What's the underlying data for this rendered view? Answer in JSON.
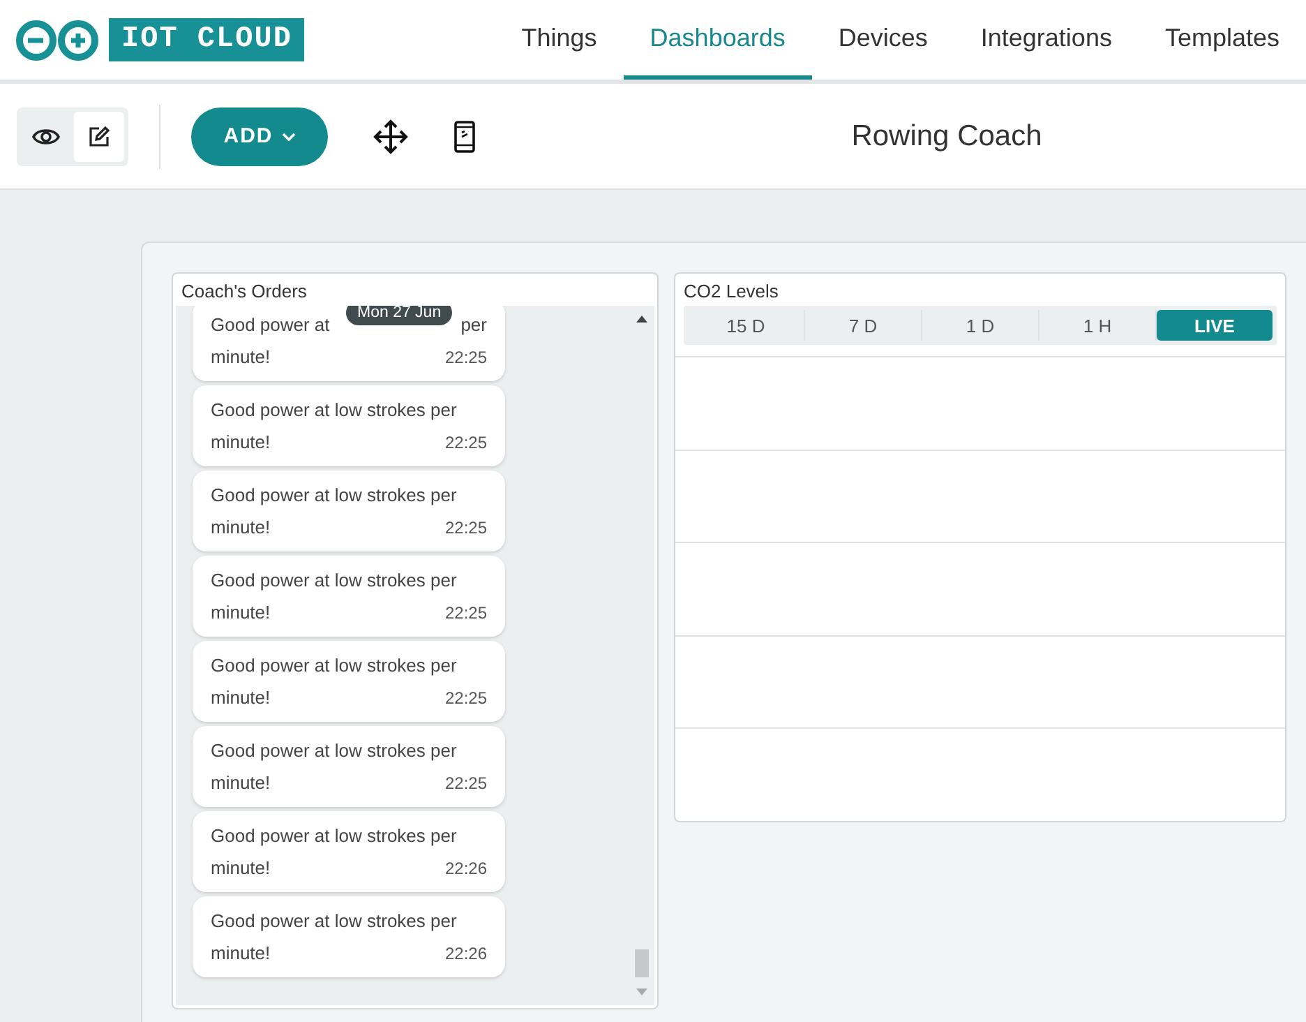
{
  "logo": {
    "text": "IOT CLOUD"
  },
  "nav": [
    {
      "label": "Things",
      "selected": false
    },
    {
      "label": "Dashboards",
      "selected": true
    },
    {
      "label": "Devices",
      "selected": false
    },
    {
      "label": "Integrations",
      "selected": false
    },
    {
      "label": "Templates",
      "selected": false
    }
  ],
  "toolbar": {
    "modes": [
      {
        "kind": "view",
        "selected": false
      },
      {
        "kind": "edit",
        "selected": true
      }
    ],
    "add_button": "ADD",
    "title": "Rowing Coach"
  },
  "widgets": {
    "messenger": {
      "title": "Coach's Orders",
      "tooltip": "Mon 27 Jun",
      "first_message": {
        "text_start": "Good power at",
        "text_end": "per",
        "line2": "minute!",
        "time": "22:25"
      },
      "messages": [
        {
          "line1": "Good power at low strokes per",
          "line2": "minute!",
          "time": "22:25"
        },
        {
          "line1": "Good power at low strokes per",
          "line2": "minute!",
          "time": "22:25"
        },
        {
          "line1": "Good power at low strokes per",
          "line2": "minute!",
          "time": "22:25"
        },
        {
          "line1": "Good power at low strokes per",
          "line2": "minute!",
          "time": "22:25"
        },
        {
          "line1": "Good power at low strokes per",
          "line2": "minute!",
          "time": "22:25"
        },
        {
          "line1": "Good power at low strokes per",
          "line2": "minute!",
          "time": "22:26"
        },
        {
          "line1": "Good power at low strokes per",
          "line2": "minute!",
          "time": "22:26"
        }
      ]
    },
    "chart": {
      "title": "CO2 Levels",
      "ranges": [
        {
          "label": "15 D",
          "selected": false
        },
        {
          "label": "7 D",
          "selected": false
        },
        {
          "label": "1 D",
          "selected": false
        },
        {
          "label": "1 H",
          "selected": false
        },
        {
          "label": "LIVE",
          "selected": true
        }
      ]
    }
  }
}
